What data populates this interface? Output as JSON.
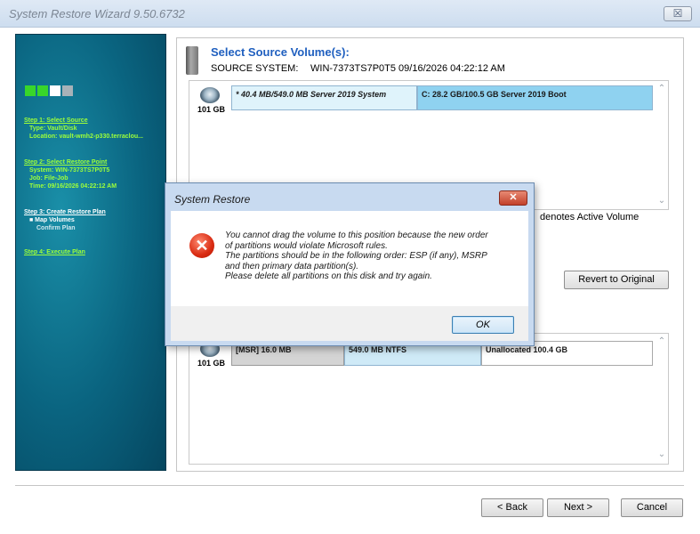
{
  "window": {
    "title": "System Restore Wizard 9.50.6732",
    "close_label": "☒"
  },
  "sidebar": {
    "step1": {
      "head": "Step 1: Select Source",
      "type": "Type: Vault/Disk",
      "location": "Location: vault-wmh2-p330.terraclou..."
    },
    "step2": {
      "head": "Step 2: Select Restore Point",
      "system": "System: WIN-7373TS7P0T5",
      "job": "Job: File-Job",
      "time": "Time: 09/16/2026 04:22:12 AM"
    },
    "step3": {
      "head": "Step 3: Create Restore Plan",
      "sub1": "■ Map Volumes",
      "sub2": "Confirm Plan"
    },
    "step4": {
      "head": "Step 4: Execute Plan"
    }
  },
  "source": {
    "title": "Select Source Volume(s):",
    "label": "SOURCE SYSTEM:",
    "value": "WIN-7373TS7P0T5 09/16/2026 04:22:12 AM",
    "disk_size": "101 GB",
    "partitions": [
      {
        "label": "* 40.4 MB/549.0 MB Server 2019 System"
      },
      {
        "label": "C: 28.2 GB/100.5 GB Server 2019 Boot"
      }
    ]
  },
  "active_note": "denotes Active Volume",
  "revert_label": "Revert to Original",
  "target": {
    "disk_size": "101 GB",
    "partitions": [
      {
        "label": "[MSR] 16.0 MB"
      },
      {
        "label": "549.0 MB NTFS"
      },
      {
        "label": "Unallocated 100.4 GB"
      }
    ]
  },
  "buttons": {
    "back": "< Back",
    "next": "Next >",
    "cancel": "Cancel"
  },
  "dialog": {
    "title": "System Restore",
    "close_label": "✕",
    "line1": "You cannot drag the volume to this position because the new order",
    "line2": "of partitions would violate Microsoft rules.",
    "line3": "The partitions should be in the following order: ESP (if any), MSRP",
    "line4": "and then primary data partition(s).",
    "line5": "Please delete all partitions on this disk and try again.",
    "ok_label": "OK"
  },
  "colors": {
    "accent": "#1f5fbf",
    "step_active": "#9dff3a",
    "partition_selected": "#8fd2f0"
  },
  "icons": {
    "error": "error-icon",
    "disk": "hard-disk-icon"
  }
}
